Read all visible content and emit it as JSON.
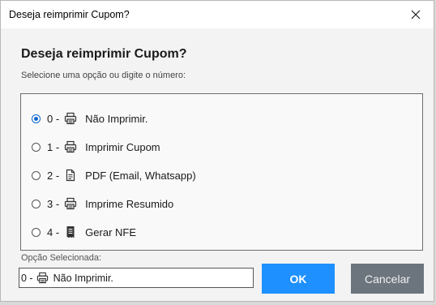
{
  "window": {
    "title": "Deseja reimprimir Cupom?",
    "close_icon": "close-icon"
  },
  "dialog": {
    "heading": "Deseja reimprimir Cupom?",
    "subheading": "Selecione uma opção ou digite o número:"
  },
  "options": [
    {
      "number": "0 -",
      "icon": "printer-icon",
      "label": "Não Imprimir.",
      "selected": true
    },
    {
      "number": "1 -",
      "icon": "printer-icon",
      "label": "Imprimir Cupom",
      "selected": false
    },
    {
      "number": "2 -",
      "icon": "document-icon",
      "label": "PDF (Email, Whatsapp)",
      "selected": false
    },
    {
      "number": "3 -",
      "icon": "printer-icon",
      "label": "Imprime Resumido",
      "selected": false
    },
    {
      "number": "4 -",
      "icon": "receipt-icon",
      "label": "Gerar NFE",
      "selected": false
    }
  ],
  "selection": {
    "label": "Opção Selecionada:",
    "number": "0 -",
    "icon": "printer-icon",
    "value": "Não Imprimir."
  },
  "buttons": {
    "ok": "OK",
    "cancel": "Cancelar"
  },
  "colors": {
    "accent": "#1e90ff",
    "radio": "#0b63c9",
    "cancel": "#6c757d"
  }
}
